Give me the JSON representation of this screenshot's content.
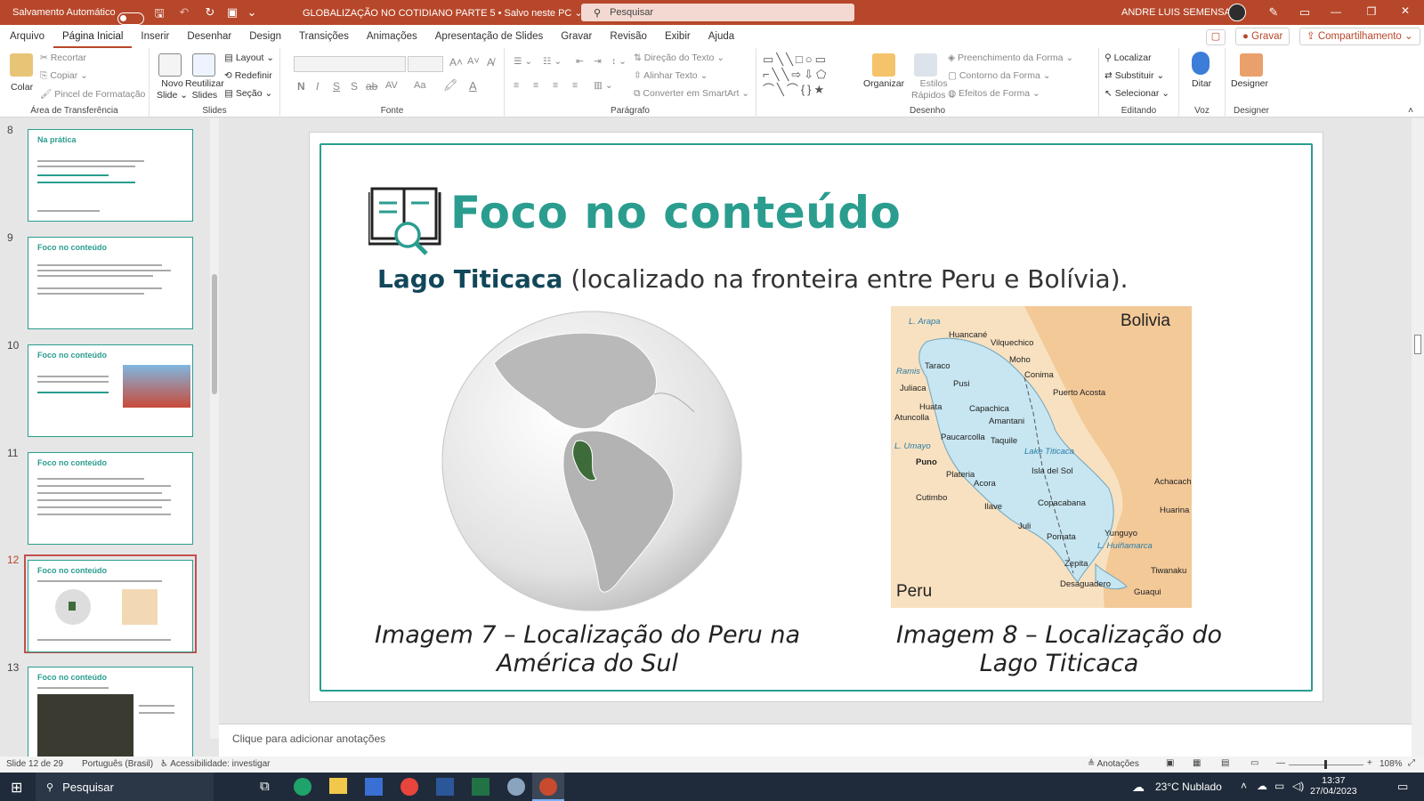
{
  "titlebar": {
    "autosave_label": "Salvamento Automático",
    "doc_title": "GLOBALIZAÇÃO NO COTIDIANO PARTE 5 • Salvo neste PC ⌄",
    "search_placeholder": "Pesquisar",
    "user_name": "ANDRE LUIS SEMENSATO"
  },
  "tabs": [
    "Arquivo",
    "Página Inicial",
    "Inserir",
    "Desenhar",
    "Design",
    "Transições",
    "Animações",
    "Apresentação de Slides",
    "Gravar",
    "Revisão",
    "Exibir",
    "Ajuda"
  ],
  "actions": {
    "record": "Gravar",
    "share": "Compartilhamento"
  },
  "ribbon": {
    "clipboard": {
      "paste": "Colar",
      "cut": "Recortar",
      "copy": "Copiar",
      "format_painter": "Pincel de Formatação",
      "label": "Área de Transferência"
    },
    "slides": {
      "new_slide_1": "Novo",
      "new_slide_2": "Slide",
      "reuse_1": "Reutilizar",
      "reuse_2": "Slides",
      "layout": "Layout",
      "reset": "Redefinir",
      "section": "Seção",
      "label": "Slides"
    },
    "font": {
      "label": "Fonte",
      "bold": "N",
      "italic": "I",
      "underline": "S",
      "shadow": "S",
      "strike": "ab",
      "spacing": "AV",
      "case": "Aa"
    },
    "paragraph": {
      "text_direction": "Direção do Texto",
      "align_text": "Alinhar Texto",
      "smartart": "Converter em SmartArt",
      "label": "Parágrafo"
    },
    "drawing": {
      "arrange": "Organizar",
      "quick_styles_1": "Estilos",
      "quick_styles_2": "Rápidos",
      "fill": "Preenchimento da Forma",
      "outline": "Contorno da Forma",
      "effects": "Efeitos de Forma",
      "label": "Desenho"
    },
    "editing": {
      "find": "Localizar",
      "replace": "Substituir",
      "select": "Selecionar",
      "label": "Editando"
    },
    "voice": {
      "dictate": "Ditar",
      "label": "Voz"
    },
    "designer": {
      "designer": "Designer",
      "label": "Designer"
    }
  },
  "thumbnails": [
    {
      "num": "8",
      "title": "Na prática"
    },
    {
      "num": "9",
      "title": "Foco no conteúdo"
    },
    {
      "num": "10",
      "title": "Foco no conteúdo"
    },
    {
      "num": "11",
      "title": "Foco no conteúdo"
    },
    {
      "num": "12",
      "title": "Foco no conteúdo"
    },
    {
      "num": "13",
      "title": "Foco no conteúdo"
    }
  ],
  "slide": {
    "title": "Foco no conteúdo",
    "subtitle_bold": "Lago Titicaca",
    "subtitle_rest": " (localizado na fronteira entre Peru e Bolívia).",
    "caption1": "Imagem 7 – Localização do Peru na América do Sul",
    "caption2": "Imagem 8 – Localização do Lago Titicaca"
  },
  "map": {
    "bolivia": "Bolivia",
    "peru": "Peru",
    "lake": "Lake Titicaca",
    "places": [
      "L. Arapa",
      "Huancané",
      "Vilquechico",
      "Moho",
      "Ramis",
      "Taraco",
      "Conima",
      "Juliaca",
      "Pusi",
      "Puerto Acosta",
      "Huata",
      "Capachica",
      "Atuncolla",
      "Amantani",
      "L. Umayo",
      "Paucarcolla",
      "Taquile",
      "Puno",
      "Plateria",
      "Isla del Sol",
      "Acora",
      "Achacachi",
      "Cutimbo",
      "Copacabana",
      "Ilave",
      "Huarina",
      "Juli",
      "Pomata",
      "Yunguyo",
      "L. Huiñamarca",
      "Zepita",
      "Tiwanaku",
      "Desaguadero",
      "Guaqui",
      "Ilave"
    ]
  },
  "notes_placeholder": "Clique para adicionar anotações",
  "status": {
    "slide_count": "Slide 12 de 29",
    "language": "Português (Brasil)",
    "accessibility": "Acessibilidade: investigar",
    "notes": "Anotações",
    "zoom": "108%"
  },
  "taskbar": {
    "search": "Pesquisar",
    "weather": "23°C  Nublado",
    "time": "13:37",
    "date": "27/04/2023"
  },
  "colors": {
    "accent": "#b7472a",
    "teal": "#2a9d8f",
    "peru_green": "#3e6b3a"
  }
}
